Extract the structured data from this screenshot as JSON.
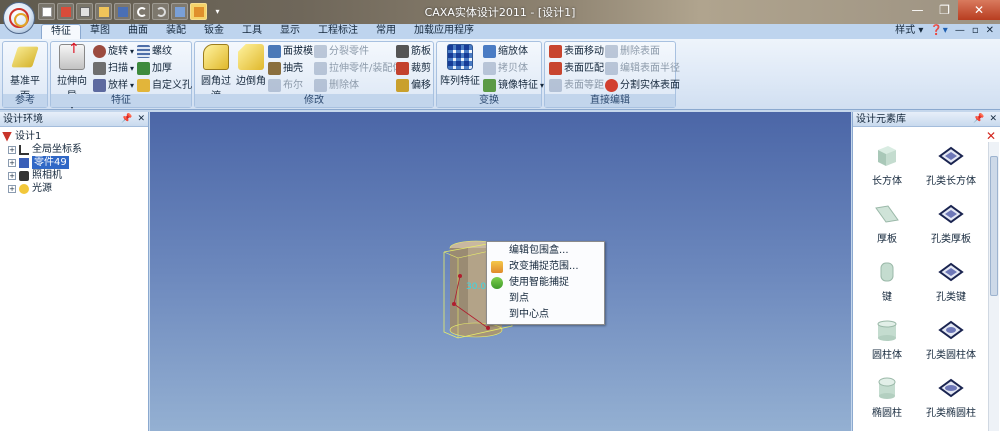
{
  "window": {
    "title": "CAXA实体设计2011 - [设计1]",
    "minimize_icon": "minimize-icon",
    "maximize_icon": "maximize-icon",
    "close_icon": "close-icon"
  },
  "tabs": [
    "特征",
    "草图",
    "曲面",
    "装配",
    "钣金",
    "工具",
    "显示",
    "工程标注",
    "常用",
    "加载应用程序"
  ],
  "tab_right": {
    "style_label": "样式"
  },
  "ribbon": {
    "groups": {
      "reference": "参考",
      "feature": "特征",
      "modify": "修改",
      "transform": "变换",
      "direct_edit": "直接编辑"
    },
    "reference": {
      "datum_plane": "基准平面"
    },
    "feature": {
      "extrude": "拉伸向导",
      "revolve": "旋转",
      "sweep": "扫描",
      "loft": "放样",
      "thread": "螺纹",
      "thicken": "加厚",
      "custom_hole": "自定义孔"
    },
    "modify": {
      "fillet": "圆角过渡",
      "chamfer": "边倒角",
      "draft": "面拔模",
      "shell": "抽壳",
      "boolean": "布尔",
      "split_part": "分裂零件",
      "stretch_part": "拉伸零件/装配体",
      "delete_body": "删除体",
      "rib": "筋板",
      "trim": "裁剪",
      "offset": "偏移"
    },
    "transform": {
      "pattern": "阵列特征",
      "scale": "缩放体",
      "copy": "拷贝体",
      "mirror": "镜像特征"
    },
    "direct_edit": {
      "face_move": "表面移动",
      "face_match": "表面匹配",
      "face_equidistant": "表面等距",
      "delete_face": "删除表面",
      "edit_face_radius": "编辑表面半径",
      "split_solid_face": "分割实体表面"
    }
  },
  "left_panel": {
    "title": "设计环境",
    "tree": [
      {
        "label": "设计1",
        "level": 0,
        "icon": "design-icon",
        "selected": false
      },
      {
        "label": "全局坐标系",
        "level": 1,
        "icon": "axis-icon",
        "selected": false
      },
      {
        "label": "零件49",
        "level": 1,
        "icon": "part-icon",
        "selected": true
      },
      {
        "label": "照相机",
        "level": 1,
        "icon": "camera-icon",
        "selected": false
      },
      {
        "label": "光源",
        "level": 1,
        "icon": "light-icon",
        "selected": false
      }
    ]
  },
  "viewport": {
    "dimension_label": "30.0",
    "context_menu": [
      {
        "label": "编辑包围盒...",
        "icon": ""
      },
      {
        "label": "改变捕捉范围...",
        "icon": "snap-range-icon"
      },
      {
        "label": "使用智能捕捉",
        "icon": "smart-snap-icon"
      },
      {
        "label": "到点",
        "icon": ""
      },
      {
        "label": "到中心点",
        "icon": ""
      }
    ]
  },
  "right_panel": {
    "title": "设计元素库",
    "items": [
      {
        "label": "长方体",
        "shape": "cuboid"
      },
      {
        "label": "孔类长方体",
        "shape": "cuboid-hole"
      },
      {
        "label": "厚板",
        "shape": "slab"
      },
      {
        "label": "孔类厚板",
        "shape": "slab-hole"
      },
      {
        "label": "键",
        "shape": "key"
      },
      {
        "label": "孔类键",
        "shape": "key-hole"
      },
      {
        "label": "圆柱体",
        "shape": "cylinder"
      },
      {
        "label": "孔类圆柱体",
        "shape": "cylinder-hole"
      },
      {
        "label": "椭圆柱",
        "shape": "ellipse-cylinder"
      },
      {
        "label": "孔类椭圆柱",
        "shape": "ellipse-cylinder-hole"
      }
    ]
  },
  "colors": {
    "accent": "#3168c6",
    "viewport_top": "#4b66a7",
    "viewport_bottom": "#94b0d2",
    "bounding_box": "#e8ee6a"
  }
}
